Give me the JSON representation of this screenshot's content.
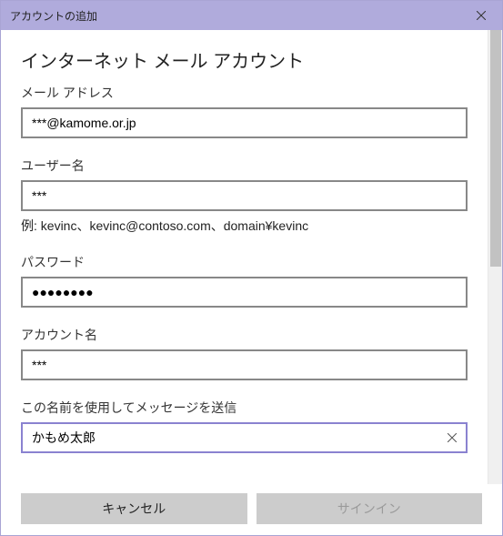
{
  "window": {
    "title": "アカウントの追加"
  },
  "page": {
    "heading": "インターネット メール アカウント"
  },
  "fields": {
    "email": {
      "label": "メール アドレス",
      "value": "***@kamome.or.jp"
    },
    "username": {
      "label": "ユーザー名",
      "value": "***",
      "hint": "例: kevinc、kevinc@contoso.com、domain¥kevinc"
    },
    "password": {
      "label": "パスワード",
      "value": "●●●●●●●●"
    },
    "account_name": {
      "label": "アカウント名",
      "value": "***"
    },
    "display_name": {
      "label": "この名前を使用してメッセージを送信",
      "value": "かもめ太郎"
    }
  },
  "buttons": {
    "cancel": "キャンセル",
    "signin": "サインイン"
  }
}
